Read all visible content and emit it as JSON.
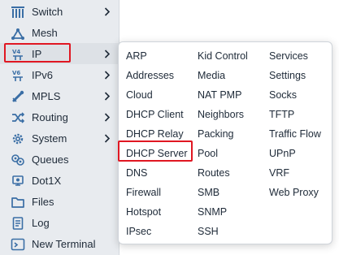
{
  "sidebar": {
    "items": [
      {
        "label": "Switch",
        "icon": "switch-icon",
        "submenu": true
      },
      {
        "label": "Mesh",
        "icon": "mesh-icon",
        "submenu": false
      },
      {
        "label": "IP",
        "icon": "ip-icon",
        "submenu": true,
        "active": true
      },
      {
        "label": "IPv6",
        "icon": "ipv6-icon",
        "submenu": true
      },
      {
        "label": "MPLS",
        "icon": "mpls-icon",
        "submenu": true
      },
      {
        "label": "Routing",
        "icon": "routing-icon",
        "submenu": true
      },
      {
        "label": "System",
        "icon": "gear-icon",
        "submenu": true
      },
      {
        "label": "Queues",
        "icon": "queues-icon",
        "submenu": false
      },
      {
        "label": "Dot1X",
        "icon": "dot1x-icon",
        "submenu": false
      },
      {
        "label": "Files",
        "icon": "folder-icon",
        "submenu": false
      },
      {
        "label": "Log",
        "icon": "log-icon",
        "submenu": false
      },
      {
        "label": "New Terminal",
        "icon": "terminal-icon",
        "submenu": false
      }
    ]
  },
  "submenu": {
    "columns": [
      [
        "ARP",
        "Addresses",
        "Cloud",
        "DHCP Client",
        "DHCP Relay",
        "DHCP Server",
        "DNS",
        "Firewall",
        "Hotspot",
        "IPsec"
      ],
      [
        "Kid Control",
        "Media",
        "NAT PMP",
        "Neighbors",
        "Packing",
        "Pool",
        "Routes",
        "SMB",
        "SNMP",
        "SSH"
      ],
      [
        "Services",
        "Settings",
        "Socks",
        "TFTP",
        "Traffic Flow",
        "UPnP",
        "VRF",
        "Web Proxy"
      ]
    ],
    "highlighted": "DHCP Server"
  },
  "colors": {
    "sidebar_bg": "#e8ebef",
    "text": "#1e2a38",
    "icon_blue": "#3a6ea5",
    "highlight_red": "#e01722"
  }
}
